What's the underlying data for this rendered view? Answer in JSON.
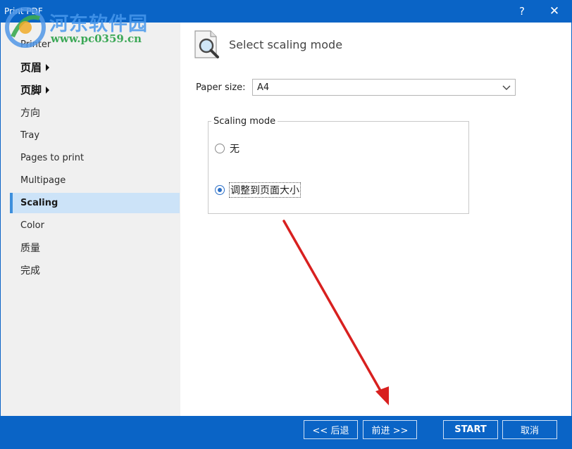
{
  "window": {
    "title": "Print PDF",
    "help_label": "?",
    "close_label": "✕"
  },
  "watermark": {
    "text_cn": "河东软件园",
    "text_url": "www.pc0359.cn"
  },
  "sidebar": {
    "items": [
      {
        "label": "Printer"
      },
      {
        "label": "页眉"
      },
      {
        "label": "页脚"
      },
      {
        "label": "方向"
      },
      {
        "label": "Tray"
      },
      {
        "label": "Pages to print"
      },
      {
        "label": "Multipage"
      },
      {
        "label": "Scaling"
      },
      {
        "label": "Color"
      },
      {
        "label": "质量"
      },
      {
        "label": "完成"
      }
    ],
    "selected": "Scaling"
  },
  "page": {
    "title": "Select scaling mode",
    "icon": "document-magnifier-icon",
    "paper_size_label": "Paper size:",
    "paper_size_value": "A4",
    "scaling_group_label": "Scaling mode",
    "options": [
      {
        "label": "无",
        "checked": false
      },
      {
        "label": "调整到页面大小",
        "checked": true
      }
    ]
  },
  "footer": {
    "back_label": "<< 后退",
    "next_label": "前进 >>",
    "start_label": "START",
    "cancel_label": "取消"
  },
  "colors": {
    "titlebar": "#0a64c6",
    "selection": "#cce3f8",
    "annotation_arrow": "#d8201f"
  }
}
